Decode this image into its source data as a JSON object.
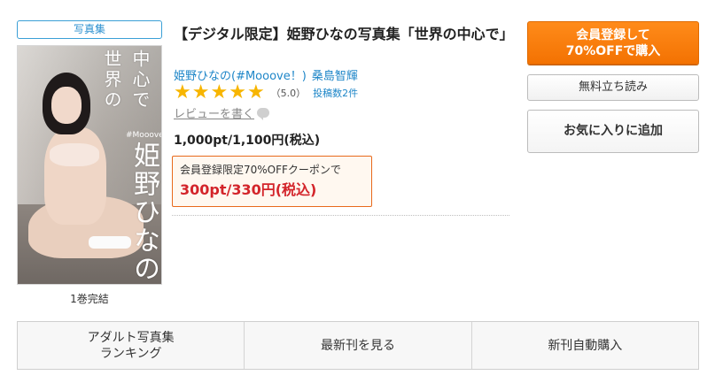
{
  "category_badge": "写真集",
  "cover": {
    "title_line1": "世界の",
    "title_line2": "中心で",
    "brand": "#Mooove!",
    "name": "姫野ひなの"
  },
  "volume_note": "1巻完結",
  "product": {
    "title": "【デジタル限定】姫野ひなの写真集「世界の中心で」",
    "authors": [
      "姫野ひなの(#Mooove！)",
      "桑島智輝"
    ],
    "rating": {
      "stars": 5,
      "score": "（5.0）",
      "review_count": "投稿数2件"
    },
    "write_review": "レビューを書く",
    "price": "1,000pt/1,100円(税込)",
    "coupon": {
      "label": "会員登録限定70%OFFクーポンで",
      "price": "300pt/330円(税込)"
    }
  },
  "buttons": {
    "register_line1": "会員登録して",
    "register_line2": "70%OFFで購入",
    "free_sample": "無料立ち読み",
    "favorite": "お気に入りに追加"
  },
  "bottom_nav": {
    "ranking_line1": "アダルト写真集",
    "ranking_line2": "ランキング",
    "latest": "最新刊を見る",
    "auto_purchase": "新刊自動購入"
  },
  "colors": {
    "accent_orange": "#f37202",
    "link_blue": "#1e86c8",
    "star_gold": "#f7b500",
    "price_red": "#d3242a"
  }
}
